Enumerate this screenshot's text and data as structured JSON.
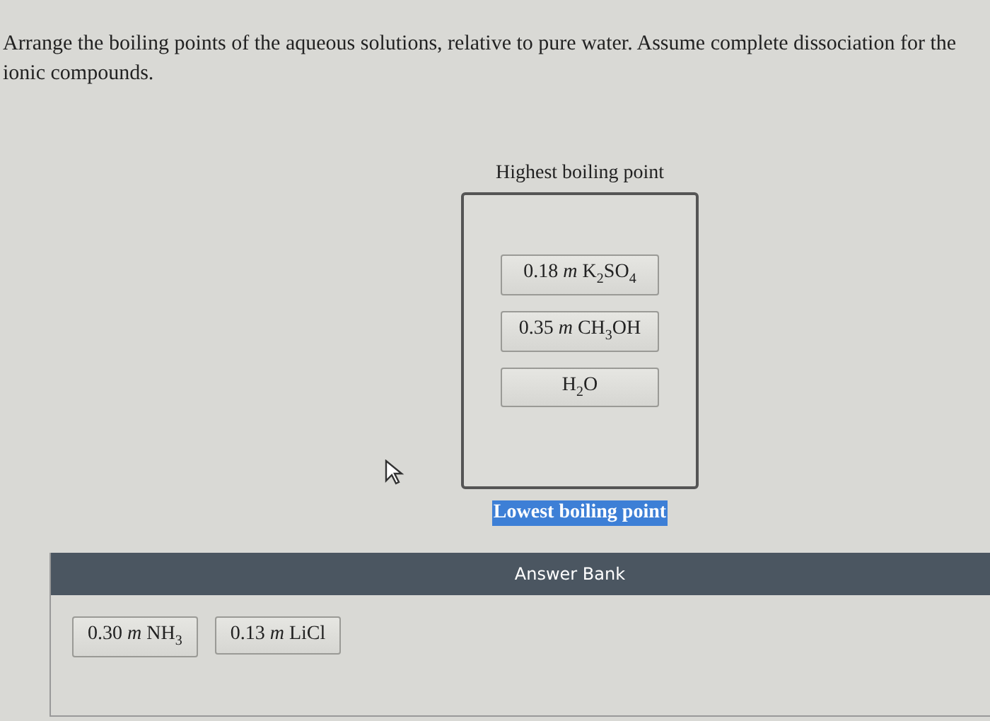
{
  "question": "Arrange the boiling points of the aqueous solutions, relative to pure water. Assume complete dissociation for the ionic compounds.",
  "ranking": {
    "top_label": "Highest boiling point",
    "items": [
      {
        "text": "0.18 *m* K$_{2}$SO$_{4}$"
      },
      {
        "text": "0.35 *m* CH$_{3}$OH"
      },
      {
        "text": "H$_{2}$O"
      }
    ],
    "bottom_label": {
      "text": "Lowest boiling point",
      "highlighted": true
    }
  },
  "answer_bank": {
    "title": "Answer Bank",
    "items": [
      {
        "text": "0.30 *m* NH$_{3}$"
      },
      {
        "text": "0.13 *m* LiCl"
      }
    ]
  }
}
